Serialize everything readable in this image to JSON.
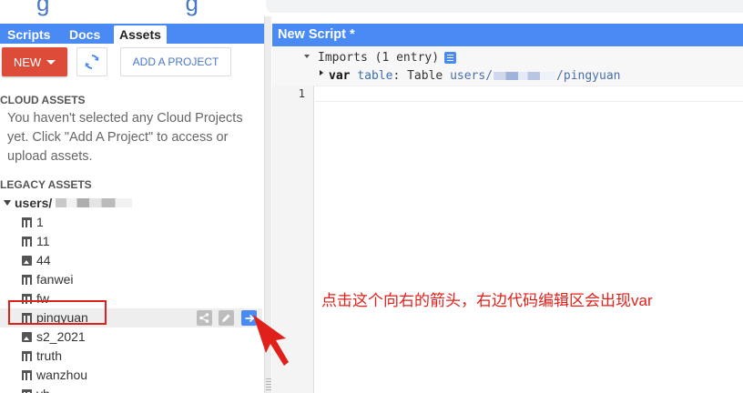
{
  "tabs": [
    {
      "label": "Scripts",
      "active": false
    },
    {
      "label": "Docs",
      "active": false
    },
    {
      "label": "Assets",
      "active": true
    }
  ],
  "toolbar": {
    "new_label": "NEW",
    "refresh_icon": "refresh-icon",
    "add_project_label": "ADD A PROJECT",
    "new_color": "#dd4b39"
  },
  "cloud_assets": {
    "heading": "CLOUD ASSETS",
    "message": "You haven't selected any Cloud Projects yet. Click \"Add A Project\" to access or upload assets."
  },
  "legacy_assets": {
    "heading": "LEGACY ASSETS",
    "root_label": "users/",
    "items": [
      {
        "label": "1",
        "icon": "table-icon"
      },
      {
        "label": "11",
        "icon": "table-icon"
      },
      {
        "label": "44",
        "icon": "image-icon"
      },
      {
        "label": "fanwei",
        "icon": "table-icon"
      },
      {
        "label": "fw",
        "icon": "table-icon"
      },
      {
        "label": "pingyuan",
        "icon": "table-icon",
        "highlighted": true
      },
      {
        "label": "s2_2021",
        "icon": "image-icon"
      },
      {
        "label": "truth",
        "icon": "table-icon"
      },
      {
        "label": "wanzhou",
        "icon": "table-icon"
      },
      {
        "label": "yh",
        "icon": "table-icon"
      }
    ]
  },
  "editor": {
    "title": "New Script *",
    "imports_label": "Imports (1 entry)",
    "import_keyword": "var",
    "import_name": "table",
    "import_colon": ":",
    "import_type": "Table",
    "import_path_prefix": "users/",
    "import_path_suffix": "/pingyuan",
    "line_number": "1"
  },
  "annotation": {
    "text": "点击这个向右的箭头，右边代码编辑区会出现var",
    "color": "#e0201a"
  },
  "colors": {
    "accent_blue": "#4a8af4",
    "annotation_red": "#e0201a"
  }
}
